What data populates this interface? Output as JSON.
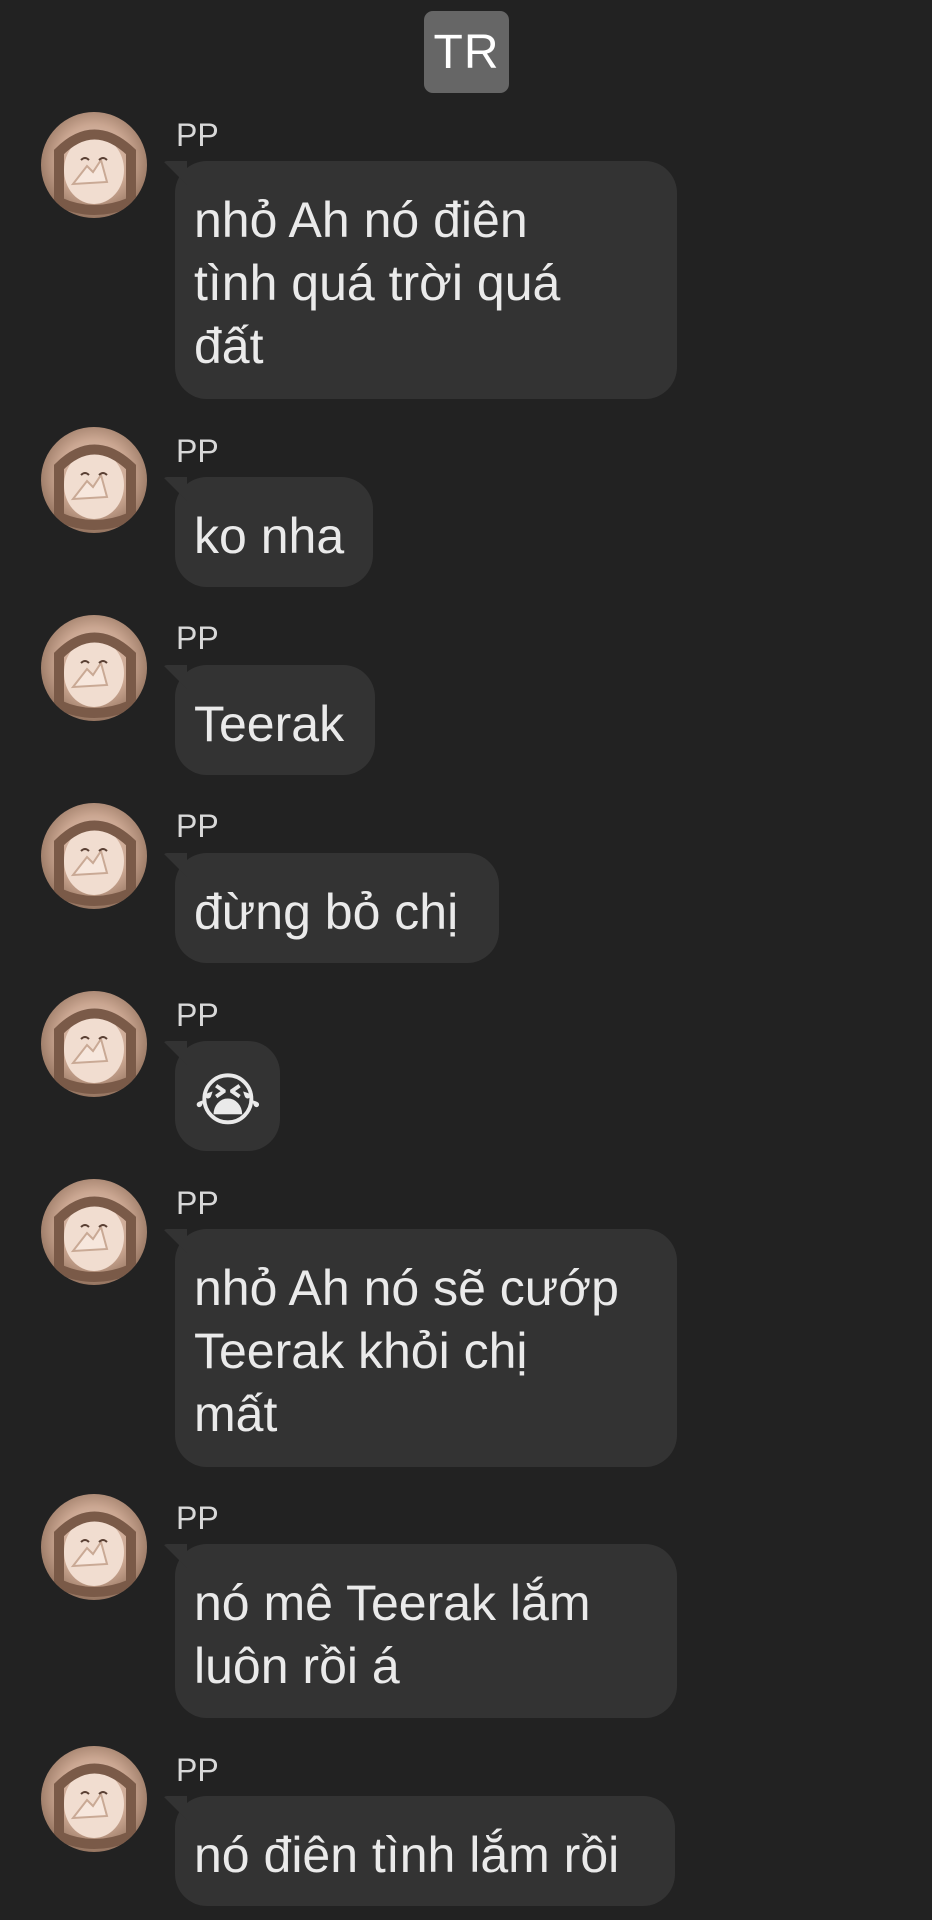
{
  "header": {
    "badge_text": "TR"
  },
  "sender_name": "PP",
  "messages": [
    {
      "sender": "PP",
      "lines": [
        "nhỏ Ah nó điên",
        "tình quá trời quá",
        "đất"
      ]
    },
    {
      "sender": "PP",
      "lines": [
        "ko nha"
      ]
    },
    {
      "sender": "PP",
      "lines": [
        "Teerak"
      ]
    },
    {
      "sender": "PP",
      "lines": [
        "đừng bỏ chị"
      ]
    },
    {
      "sender": "PP",
      "lines": [
        "😭"
      ]
    },
    {
      "sender": "PP",
      "lines": [
        "nhỏ Ah nó sẽ cướp",
        "Teerak khỏi chị",
        "mất"
      ]
    },
    {
      "sender": "PP",
      "lines": [
        "nó mê Teerak lắm",
        "luôn rồi á"
      ]
    },
    {
      "sender": "PP",
      "lines": [
        "nó điên tình lắm rồi"
      ]
    }
  ],
  "colors": {
    "background": "#222222",
    "bubble": "#333333",
    "badge": "#666666",
    "text": "#eaeaea"
  },
  "icons": {
    "avatar": "user-photo-avatar",
    "emoji": "loudly-crying-face"
  }
}
